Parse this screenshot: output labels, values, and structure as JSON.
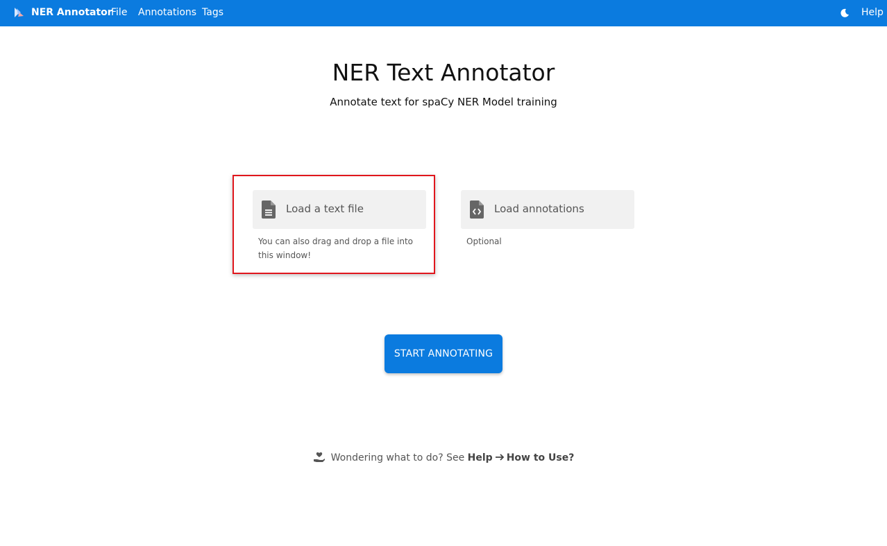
{
  "navbar": {
    "brand": "NER Annotator",
    "menu": [
      "File",
      "Annotations",
      "Tags"
    ],
    "theme_icon": "moon-icon",
    "help": "Help",
    "color": "#0b7bdf"
  },
  "hero": {
    "title": "NER Text Annotator",
    "subtitle": "Annotate text for spaCy NER Model training"
  },
  "load_text": {
    "label": "Load a text file",
    "hint_line1": "You can also drag and drop a file into",
    "hint_line2": "this window!",
    "icon": "file-text-icon"
  },
  "load_annotations": {
    "label": "Load annotations",
    "hint": "Optional",
    "icon": "file-code-icon"
  },
  "start_button": "START ANNOTATING",
  "footer": {
    "text": "Wondering what to do? See",
    "help": "Help",
    "how_to": "How to Use?"
  }
}
